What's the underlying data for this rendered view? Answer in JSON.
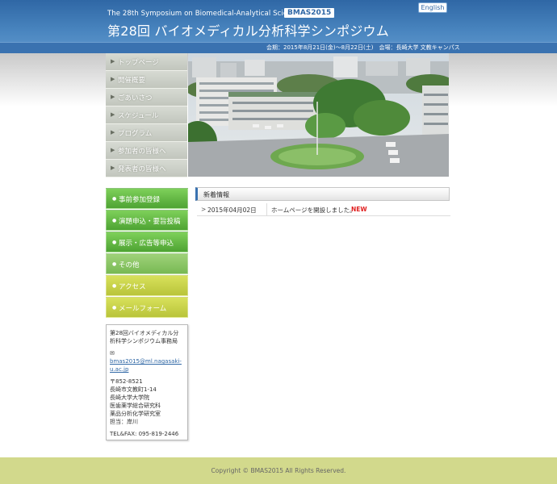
{
  "header": {
    "subtitle": "The 28th Symposium on Biomedical-Analytical Sciences",
    "badge": "BMAS2015",
    "title": "第28回 バイオメディカル分析科学シンポジウム",
    "english_button": "English",
    "info": "会期：2015年8月21日(金)〜8月22日(土)　会場：長崎大学 文教キャンパス",
    "colors": {
      "primary": "#3a72b0",
      "accent_green": "#5aad3a",
      "accent_yellow": "#c9d24a"
    }
  },
  "top_nav": [
    {
      "label": "トップページ"
    },
    {
      "label": "開催概要"
    },
    {
      "label": "ごあいさつ"
    },
    {
      "label": "スケジュール"
    },
    {
      "label": "プログラム"
    },
    {
      "label": "参加者の皆様へ"
    },
    {
      "label": "発表者の皆様へ"
    }
  ],
  "side_menu": [
    {
      "label": "事前参加登録"
    },
    {
      "label": "演題申込・要旨投稿"
    },
    {
      "label": "展示・広告等申込"
    },
    {
      "label": "その他"
    },
    {
      "label": "アクセス"
    },
    {
      "label": "メールフォーム"
    }
  ],
  "contact": {
    "org": "第28回バイオメディカル分析科学シンポジウム事務局",
    "mail_icon": "✉",
    "email": "bmas2015@ml.nagasaki-u.ac.jp",
    "address_lines": [
      "〒852-8521",
      "長崎市文教町1-14",
      "長崎大学大学院",
      "医歯薬学総合研究科",
      "薬品分析化学研究室",
      "担当：岸川"
    ],
    "tel": "TEL&FAX: 095-819-2446"
  },
  "news": {
    "heading": "新着情報",
    "items": [
      {
        "marker": ">",
        "date": "2015年04月02日",
        "text": "ホームページを開設しました。",
        "badge": "NEW"
      }
    ]
  },
  "footer": {
    "copyright": "Copyright © BMAS2015 All Rights Reserved."
  }
}
